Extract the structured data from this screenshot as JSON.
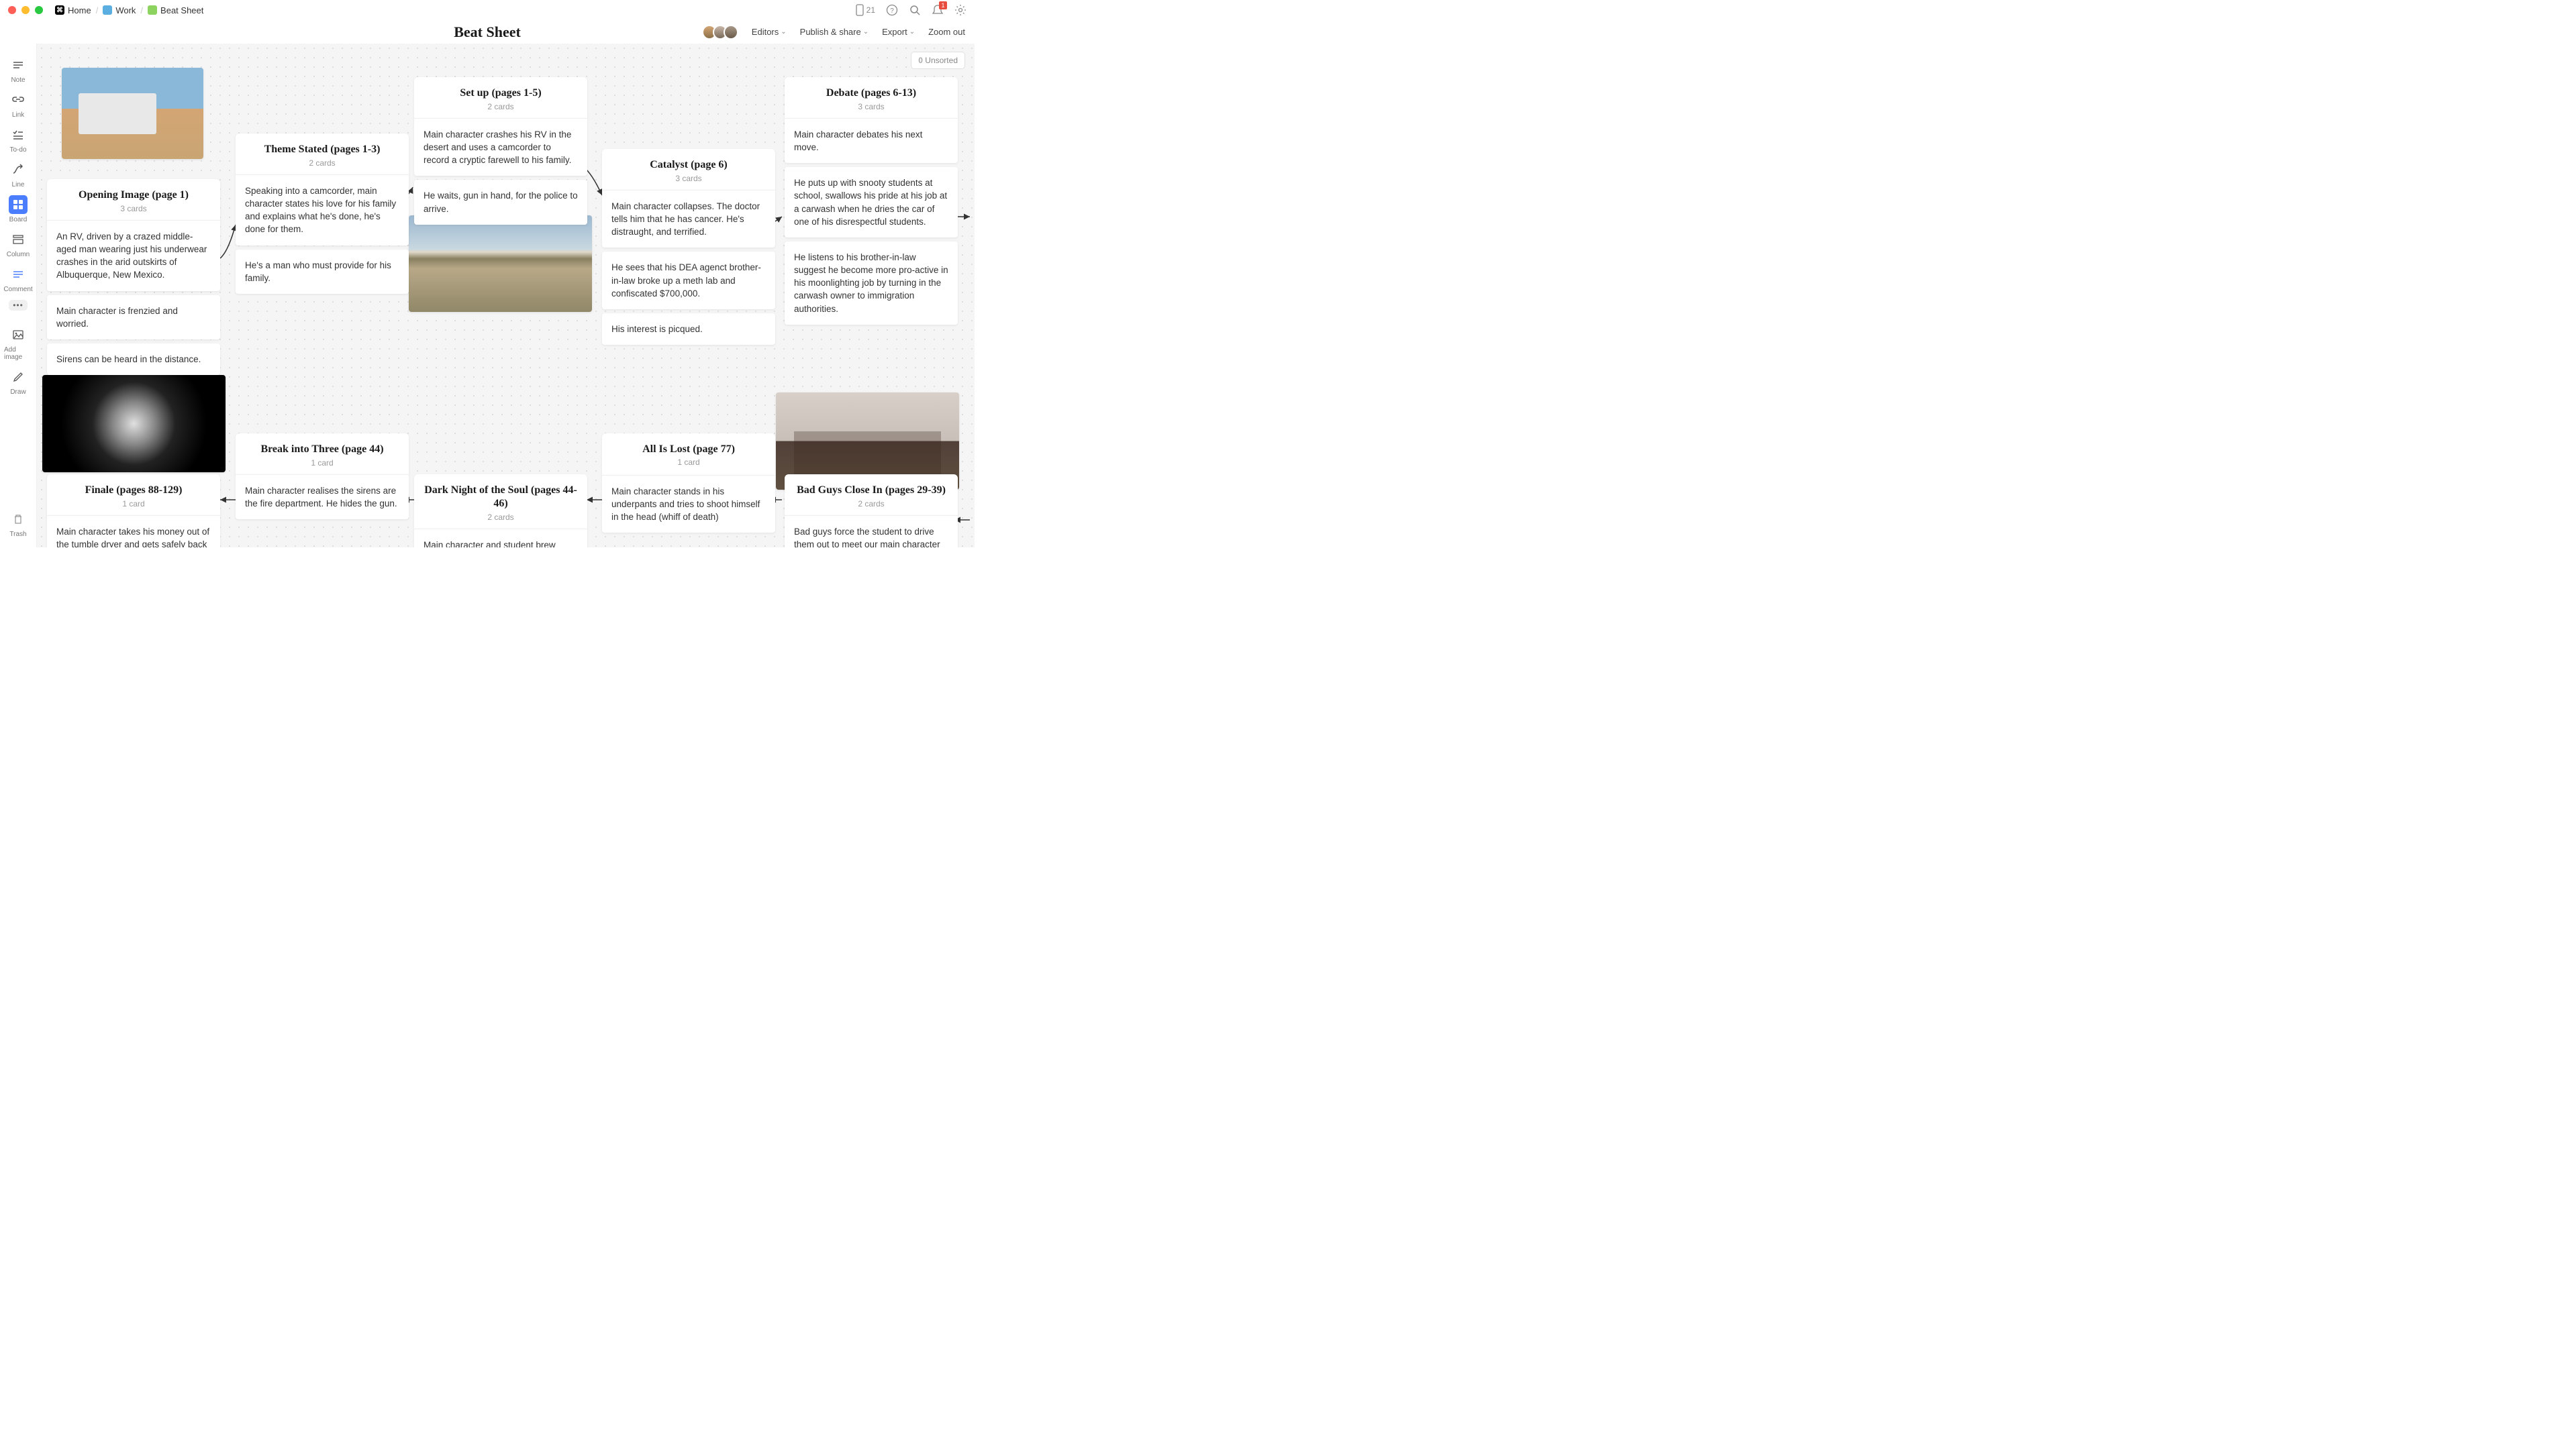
{
  "breadcrumb": {
    "home": "Home",
    "work": "Work",
    "sheet": "Beat Sheet"
  },
  "topRight": {
    "deviceCount": "21",
    "bellBadge": "1"
  },
  "pageTitle": "Beat Sheet",
  "menus": {
    "editors": "Editors",
    "publish": "Publish & share",
    "export": "Export",
    "zoomOut": "Zoom out"
  },
  "tools": {
    "note": "Note",
    "link": "Link",
    "todo": "To-do",
    "line": "Line",
    "board": "Board",
    "column": "Column",
    "comment": "Comment",
    "addImage": "Add image",
    "draw": "Draw",
    "trash": "Trash"
  },
  "unsorted": {
    "count": "0",
    "label": "Unsorted"
  },
  "stacks": {
    "opening": {
      "title": "Opening Image (page 1)",
      "count": "3 cards",
      "c1": "An RV, driven by a crazed middle-aged man wearing just his underwear crashes in the arid outskirts of Albuquerque, New Mexico.",
      "c2": "Main character is frenzied and worried.",
      "c3": "Sirens can be heard in the distance."
    },
    "theme": {
      "title": "Theme Stated (pages 1-3)",
      "count": "2 cards",
      "c1": "Speaking into a camcorder, main character states his love for his family and explains what he's done, he's done for them.",
      "c2": "He's a man who must provide for his family."
    },
    "setup": {
      "title": "Set up (pages 1-5)",
      "count": "2 cards",
      "c1": "Main character crashes his RV in the desert and uses a camcorder to record a cryptic farewell to his family.",
      "c2": "He waits, gun in hand, for the police to arrive."
    },
    "catalyst": {
      "title": "Catalyst (page 6)",
      "count": "3 cards",
      "c1": "Main character collapses. The doctor tells him that he has cancer. He's distraught, and terrified.",
      "c2": "He sees that his DEA agenct brother-in-law broke up a meth lab and confiscated $700,000.",
      "c3": "His interest is picqued."
    },
    "debate": {
      "title": "Debate (pages 6-13)",
      "count": "3 cards",
      "c1": "Main character debates his next move.",
      "c2": "He puts up with snooty students at school, swallows his pride at his job at a carwash when he dries the car of one of his disrespectful students.",
      "c3": "He listens to his brother-in-law suggest he become more pro-active in his moonlighting job by turning in the carwash owner to immigration authorities."
    },
    "break3": {
      "title": "Break into Three (page 44)",
      "count": "1 card",
      "c1": "Main character realises the sirens are the fire department. He hides the gun."
    },
    "darkNight": {
      "title": "Dark Night of the Soul (pages 44-46)",
      "count": "2 cards",
      "c1": "Main character and student brew meth in the RV"
    },
    "allLost": {
      "title": "All Is Lost (page 77)",
      "count": "1 card",
      "c1": "Main character stands in his underpants and tries to shoot himself in the head (whiff of death)"
    },
    "badGuys": {
      "title": "Bad Guys Close In (pages 29-39)",
      "count": "2 cards",
      "c1": "Bad guys force the student to drive them out to meet our main character and  talk about killing the two of them"
    },
    "finale": {
      "title": "Finale (pages 88-129)",
      "count": "1 card",
      "c1": "Main character takes his money out of the tumble dryer and gets safely back in bed"
    }
  }
}
